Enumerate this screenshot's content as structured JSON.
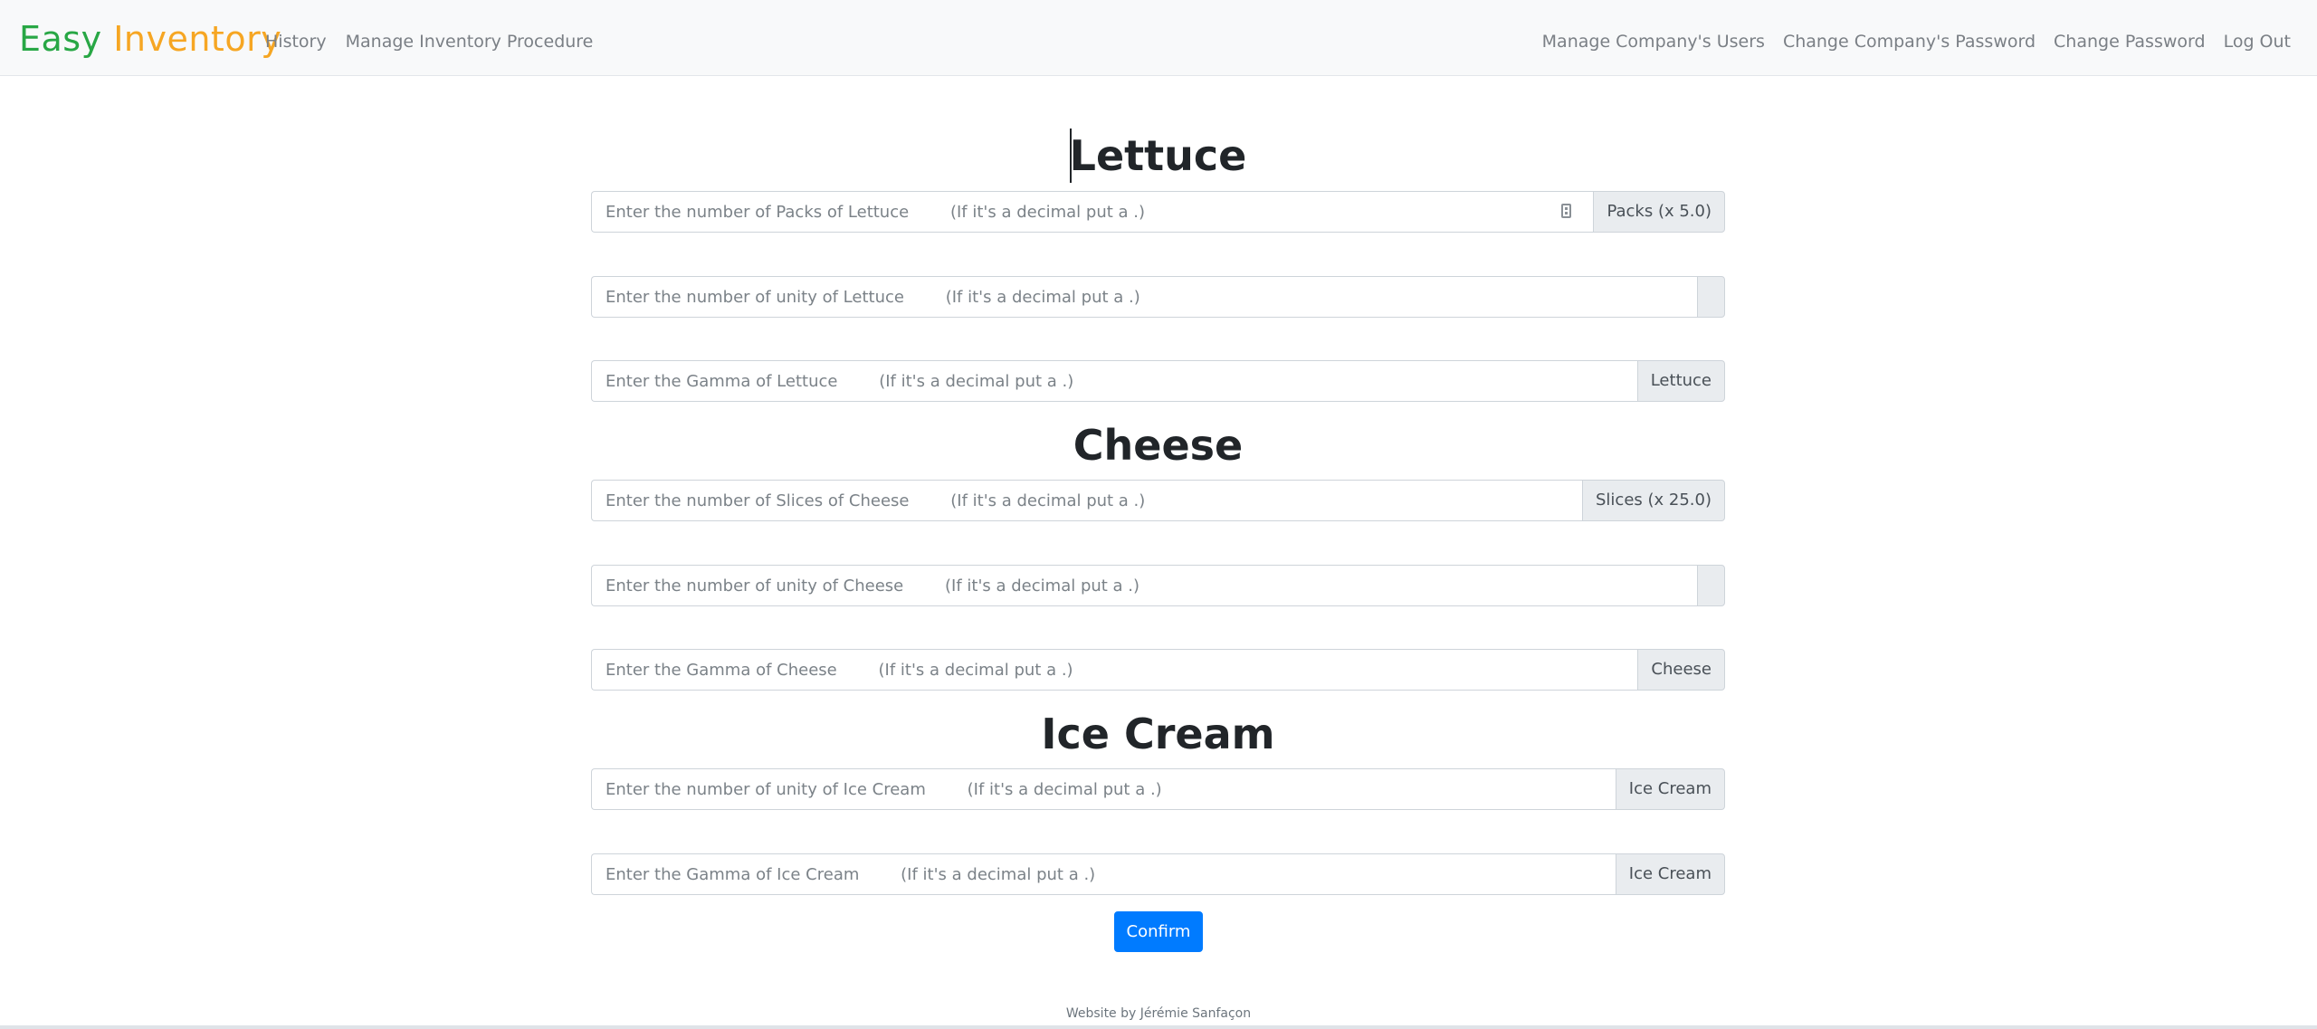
{
  "nav": {
    "brand_part1": "Easy",
    "brand_part2": "Inventory",
    "left_links": [
      "History",
      "Manage Inventory Procedure"
    ],
    "right_links": [
      "Manage Company's Users",
      "Change Company's Password",
      "Change Password",
      "Log Out"
    ]
  },
  "sections": {
    "lettuce": {
      "title": "Lettuce",
      "packs_placeholder": "Enter the number of Packs of Lettuce        (If it's a decimal put a .)",
      "packs_addon": "Packs (x 5.0)",
      "unity_placeholder": "Enter the number of unity of Lettuce        (If it's a decimal put a .)",
      "unity_addon": "",
      "gamma_placeholder": "Enter the Gamma of Lettuce        (If it's a decimal put a .)",
      "gamma_addon": "Lettuce"
    },
    "cheese": {
      "title": "Cheese",
      "slices_placeholder": "Enter the number of Slices of Cheese        (If it's a decimal put a .)",
      "slices_addon": "Slices (x 25.0)",
      "unity_placeholder": "Enter the number of unity of Cheese        (If it's a decimal put a .)",
      "unity_addon": "",
      "gamma_placeholder": "Enter the Gamma of Cheese        (If it's a decimal put a .)",
      "gamma_addon": "Cheese"
    },
    "ice_cream": {
      "title": "Ice Cream",
      "unity_placeholder": "Enter the number of unity of Ice Cream        (If it's a decimal put a .)",
      "unity_addon": "Ice Cream",
      "gamma_placeholder": "Enter the Gamma of Ice Cream        (If it's a decimal put a .)",
      "gamma_addon": "Ice Cream"
    }
  },
  "confirm_label": "Confirm",
  "footer_text": "Website by Jérémie Sanfaçon",
  "colors": {
    "brand_green": "#28a745",
    "brand_orange": "#f6a623",
    "primary": "#007bff"
  }
}
